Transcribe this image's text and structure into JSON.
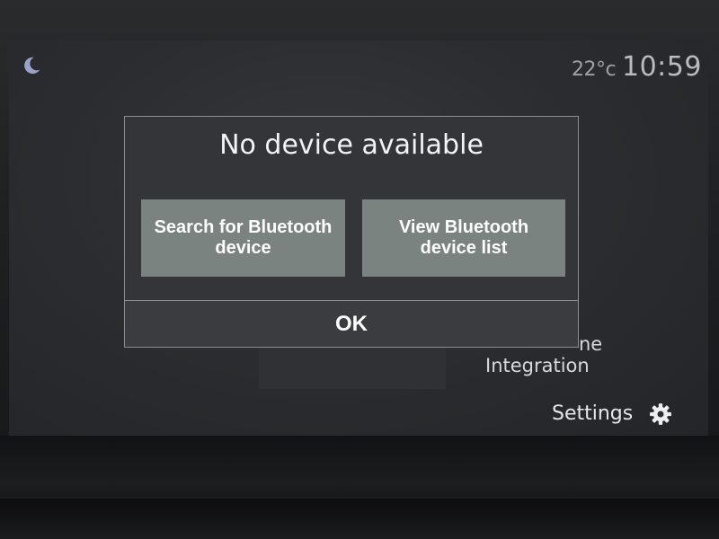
{
  "status_bar": {
    "night_mode_icon": "moon-icon",
    "temperature": "22°c",
    "time": "10:59"
  },
  "background": {
    "phone_integration_label_1": "ne",
    "phone_integration_label_2": "Integration",
    "settings_label": "Settings",
    "settings_icon": "gear-icon"
  },
  "dialog": {
    "title": "No device available",
    "search_button_label": "Search for Bluetooth device",
    "view_list_button_label": "View Bluetooth device list",
    "ok_label": "OK"
  },
  "colors": {
    "dialog_button": "#7a837f",
    "dialog_background": "#333538",
    "screen_background": "#2b2d30"
  }
}
